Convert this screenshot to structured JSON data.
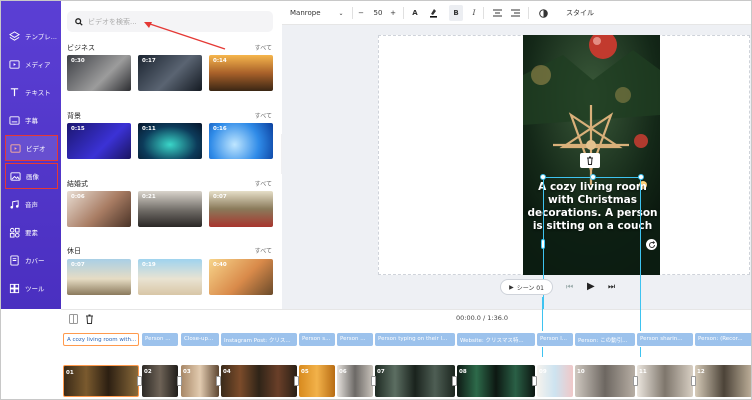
{
  "sidebar": {
    "items": [
      {
        "label": "テンプレ...",
        "icon": "layers-icon"
      },
      {
        "label": "メディア",
        "icon": "media-folder-icon"
      },
      {
        "label": "テキスト",
        "icon": "text-icon"
      },
      {
        "label": "字幕",
        "icon": "subtitle-icon"
      },
      {
        "label": "ビデオ",
        "icon": "video-icon"
      },
      {
        "label": "画像",
        "icon": "image-icon"
      },
      {
        "label": "音声",
        "icon": "music-icon"
      },
      {
        "label": "要素",
        "icon": "elements-icon"
      },
      {
        "label": "カバー",
        "icon": "cover-icon"
      },
      {
        "label": "ツール",
        "icon": "tools-icon"
      }
    ]
  },
  "media_panel": {
    "search_placeholder": "ビデオを検索...",
    "see_all": "すべて",
    "categories": [
      {
        "name": "ビジネス",
        "durations": [
          "0:30",
          "0:17",
          "0:14"
        ]
      },
      {
        "name": "背景",
        "durations": [
          "0:15",
          "0:11",
          "0:16"
        ]
      },
      {
        "name": "結婚式",
        "durations": [
          "0:06",
          "0:21",
          "0:07"
        ]
      },
      {
        "name": "休日",
        "durations": [
          "0:07",
          "0:19",
          "0:40"
        ]
      }
    ]
  },
  "toolbar": {
    "font": "Manrope",
    "font_size": "50",
    "minus": "−",
    "plus": "+",
    "bold": "B",
    "italic": "I",
    "style_label": "スタイル"
  },
  "canvas": {
    "caption": "A cozy living room with Christmas decorations. A person is sitting on a couch",
    "scene_label": "シーン 01"
  },
  "timeline": {
    "time": "00:00.0 / 1:36.0",
    "chips": [
      "A cozy living room with...",
      "Person ...",
      "Close-up...",
      "Instagram Post: クリス...",
      "Person s...",
      "Person ...",
      "Person typing on their l...",
      "Website: クリスマス特...",
      "Person l...",
      "Person: この動引...",
      "Person sharin...",
      "Person: (Recor..."
    ],
    "clip_numbers": [
      "01",
      "02",
      "03",
      "04",
      "05",
      "06",
      "07",
      "08",
      "09",
      "10",
      "11",
      "12"
    ]
  },
  "colors": {
    "sidebar_bg": "#4f34c8",
    "accent": "#6b4ef0",
    "highlight": "#e53935",
    "chip": "#9cc2ec",
    "selection": "#3ec3f0"
  }
}
